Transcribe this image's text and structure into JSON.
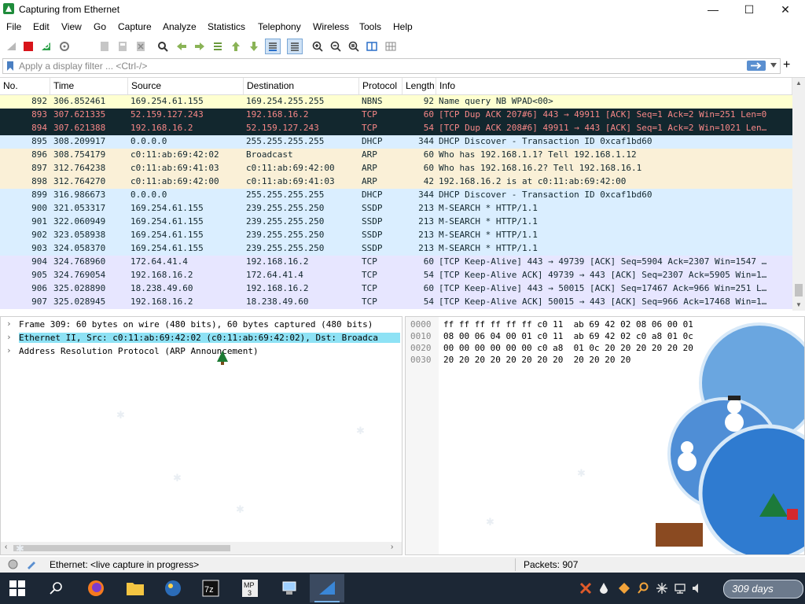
{
  "window": {
    "title": "Capturing from Ethernet",
    "minimize_glyph": "—",
    "maximize_glyph": "☐",
    "close_glyph": "✕"
  },
  "menu": [
    "File",
    "Edit",
    "View",
    "Go",
    "Capture",
    "Analyze",
    "Statistics",
    "Telephony",
    "Wireless",
    "Tools",
    "Help"
  ],
  "filter": {
    "placeholder": "Apply a display filter ... <Ctrl-/>",
    "add_glyph": "+"
  },
  "packet_columns": [
    "No.",
    "Time",
    "Source",
    "Destination",
    "Protocol",
    "Length",
    "Info"
  ],
  "packets": [
    {
      "no": "892",
      "time": "306.852461",
      "src": "169.254.61.155",
      "dst": "169.254.255.255",
      "proto": "NBNS",
      "len": "92",
      "info": "Name query NB WPAD<00>",
      "bg": "#feffd0",
      "fg": "#12272e"
    },
    {
      "no": "893",
      "time": "307.621335",
      "src": "52.159.127.243",
      "dst": "192.168.16.2",
      "proto": "TCP",
      "len": "60",
      "info": "[TCP Dup ACK 207#6] 443 → 49911 [ACK] Seq=1 Ack=2 Win=251 Len=0",
      "bg": "#12272e",
      "fg": "#f78787"
    },
    {
      "no": "894",
      "time": "307.621388",
      "src": "192.168.16.2",
      "dst": "52.159.127.243",
      "proto": "TCP",
      "len": "54",
      "info": "[TCP Dup ACK 208#6] 49911 → 443 [ACK] Seq=1 Ack=2 Win=1021 Len…",
      "bg": "#12272e",
      "fg": "#f78787"
    },
    {
      "no": "895",
      "time": "308.209917",
      "src": "0.0.0.0",
      "dst": "255.255.255.255",
      "proto": "DHCP",
      "len": "344",
      "info": "DHCP Discover - Transaction ID 0xcaf1bd60",
      "bg": "#daeeff",
      "fg": "#12272e"
    },
    {
      "no": "896",
      "time": "308.754179",
      "src": "c0:11:ab:69:42:02",
      "dst": "Broadcast",
      "proto": "ARP",
      "len": "60",
      "info": "Who has 192.168.1.1? Tell 192.168.1.12",
      "bg": "#faf0d7",
      "fg": "#12272e"
    },
    {
      "no": "897",
      "time": "312.764238",
      "src": "c0:11:ab:69:41:03",
      "dst": "c0:11:ab:69:42:00",
      "proto": "ARP",
      "len": "60",
      "info": "Who has 192.168.16.2? Tell 192.168.16.1",
      "bg": "#faf0d7",
      "fg": "#12272e"
    },
    {
      "no": "898",
      "time": "312.764270",
      "src": "c0:11:ab:69:42:00",
      "dst": "c0:11:ab:69:41:03",
      "proto": "ARP",
      "len": "42",
      "info": "192.168.16.2 is at c0:11:ab:69:42:00",
      "bg": "#faf0d7",
      "fg": "#12272e"
    },
    {
      "no": "899",
      "time": "316.986673",
      "src": "0.0.0.0",
      "dst": "255.255.255.255",
      "proto": "DHCP",
      "len": "344",
      "info": "DHCP Discover - Transaction ID 0xcaf1bd60",
      "bg": "#daeeff",
      "fg": "#12272e"
    },
    {
      "no": "900",
      "time": "321.053317",
      "src": "169.254.61.155",
      "dst": "239.255.255.250",
      "proto": "SSDP",
      "len": "213",
      "info": "M-SEARCH * HTTP/1.1",
      "bg": "#daeeff",
      "fg": "#12272e"
    },
    {
      "no": "901",
      "time": "322.060949",
      "src": "169.254.61.155",
      "dst": "239.255.255.250",
      "proto": "SSDP",
      "len": "213",
      "info": "M-SEARCH * HTTP/1.1",
      "bg": "#daeeff",
      "fg": "#12272e"
    },
    {
      "no": "902",
      "time": "323.058938",
      "src": "169.254.61.155",
      "dst": "239.255.255.250",
      "proto": "SSDP",
      "len": "213",
      "info": "M-SEARCH * HTTP/1.1",
      "bg": "#daeeff",
      "fg": "#12272e"
    },
    {
      "no": "903",
      "time": "324.058370",
      "src": "169.254.61.155",
      "dst": "239.255.255.250",
      "proto": "SSDP",
      "len": "213",
      "info": "M-SEARCH * HTTP/1.1",
      "bg": "#daeeff",
      "fg": "#12272e"
    },
    {
      "no": "904",
      "time": "324.768960",
      "src": "172.64.41.4",
      "dst": "192.168.16.2",
      "proto": "TCP",
      "len": "60",
      "info": "[TCP Keep-Alive] 443 → 49739 [ACK] Seq=5904 Ack=2307 Win=1547 …",
      "bg": "#e7e6ff",
      "fg": "#12272e"
    },
    {
      "no": "905",
      "time": "324.769054",
      "src": "192.168.16.2",
      "dst": "172.64.41.4",
      "proto": "TCP",
      "len": "54",
      "info": "[TCP Keep-Alive ACK] 49739 → 443 [ACK] Seq=2307 Ack=5905 Win=1…",
      "bg": "#e7e6ff",
      "fg": "#12272e"
    },
    {
      "no": "906",
      "time": "325.028890",
      "src": "18.238.49.60",
      "dst": "192.168.16.2",
      "proto": "TCP",
      "len": "60",
      "info": "[TCP Keep-Alive] 443 → 50015 [ACK] Seq=17467 Ack=966 Win=251 L…",
      "bg": "#e7e6ff",
      "fg": "#12272e"
    },
    {
      "no": "907",
      "time": "325.028945",
      "src": "192.168.16.2",
      "dst": "18.238.49.60",
      "proto": "TCP",
      "len": "54",
      "info": "[TCP Keep-Alive ACK] 50015 → 443 [ACK] Seq=966 Ack=17468 Win=1…",
      "bg": "#e7e6ff",
      "fg": "#12272e"
    }
  ],
  "details": [
    {
      "text": "Frame 309: 60 bytes on wire (480 bits), 60 bytes captured (480 bits)",
      "selected": false
    },
    {
      "text": "Ethernet II, Src: c0:11:ab:69:42:02 (c0:11:ab:69:42:02), Dst: Broadca",
      "selected": true
    },
    {
      "text": "Address Resolution Protocol (ARP Announcement)",
      "selected": false
    }
  ],
  "bytes": [
    {
      "offset": "0000",
      "hex": "ff ff ff ff ff ff c0 11  ab 69 42 02 08 06 00 01"
    },
    {
      "offset": "0010",
      "hex": "08 00 06 04 00 01 c0 11  ab 69 42 02 c0 a8 01 0c"
    },
    {
      "offset": "0020",
      "hex": "00 00 00 00 00 00 c0 a8  01 0c 20 20 20 20 20 20"
    },
    {
      "offset": "0030",
      "hex": "20 20 20 20 20 20 20 20  20 20 20 20"
    }
  ],
  "status": {
    "interface": "Ethernet: <live capture in progress>",
    "packets": "Packets: 907"
  },
  "widget": {
    "days_text": "309 days"
  },
  "colors": {
    "selected_detail": "#8ee2f5",
    "taskbar": "#1c2735",
    "accent": "#3a7bd5"
  }
}
